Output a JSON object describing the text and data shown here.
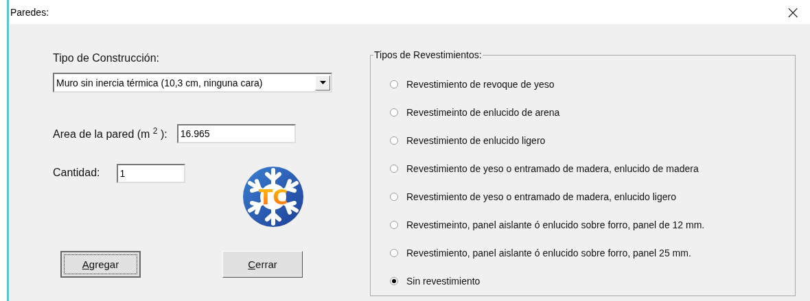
{
  "window": {
    "title": "Paredes:",
    "close": "×"
  },
  "construction": {
    "label": "Tipo de Construcción:",
    "value": "Muro sin inercia térmica (10,3 cm, ninguna cara)"
  },
  "area": {
    "label": "Area de la pared (m $^{2}$ ):",
    "value": "16.965"
  },
  "quantity": {
    "label": "Cantidad:",
    "value": "1"
  },
  "logo": {
    "text": "TC"
  },
  "buttons": [
    {
      "label": "Agregar",
      "first_letter_underlined": true,
      "focused": true
    },
    {
      "label": "Cerrar",
      "first_letter_underlined": true,
      "focused": false
    }
  ],
  "coatings": {
    "title": "Tipos de Revestimientos:",
    "options": [
      {
        "label": "Revestimiento de revoque de yeso",
        "selected": false
      },
      {
        "label": "Revestimeinto de enlucido de arena",
        "selected": false
      },
      {
        "label": "Revestimiento de enlucido ligero",
        "selected": false
      },
      {
        "label": "Revestimiento de yeso o entramado  de madera,  enlucido de madera",
        "selected": false
      },
      {
        "label": "Revestimiento de yeso o entramado de madera, enlucido ligero",
        "selected": false
      },
      {
        "label": "Revestimeinto, panel aislante ó enlucido sobre forro, panel de 12 mm.",
        "selected": false
      },
      {
        "label": "Revestimiento, panel aislante ó enlucido sobre forro, panel 25 mm.",
        "selected": false
      },
      {
        "label": "Sin revestimiento",
        "selected": true
      }
    ]
  }
}
